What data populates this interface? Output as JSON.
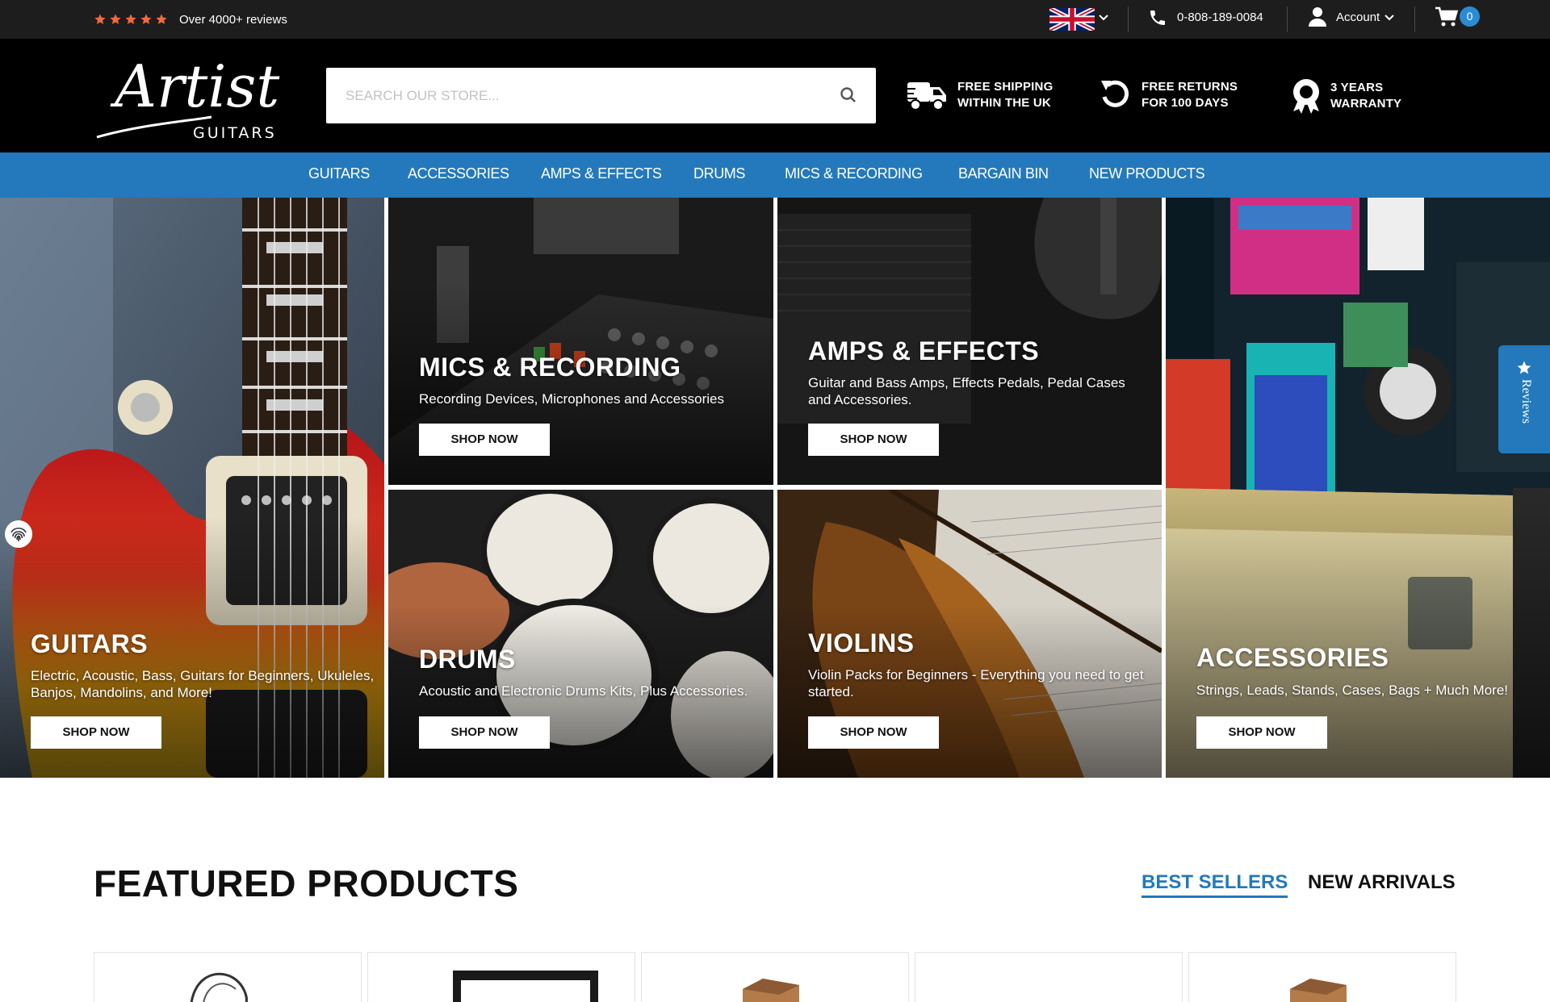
{
  "topbar": {
    "rating_stars": 5,
    "reviews_text": "Over 4000+ reviews",
    "phone": "0-808-189-0084",
    "account_label": "Account",
    "cart_count": "0"
  },
  "header": {
    "logo_script": "Artist",
    "logo_sub": "GUITARS",
    "search_placeholder": "SEARCH OUR STORE...",
    "perks": [
      {
        "line1": "FREE SHIPPING",
        "line2": "WITHIN THE UK",
        "icon": "truck-icon"
      },
      {
        "line1": "FREE RETURNS",
        "line2": "FOR 100 DAYS",
        "icon": "return-icon"
      },
      {
        "line1": "3 YEARS",
        "line2": "WARRANTY",
        "icon": "award-icon"
      }
    ]
  },
  "nav": {
    "items": [
      {
        "label": "GUITARS"
      },
      {
        "label": "ACCESSORIES"
      },
      {
        "label": "AMPS & EFFECTS"
      },
      {
        "label": "DRUMS"
      },
      {
        "label": "MICS & RECORDING"
      },
      {
        "label": "BARGAIN BIN"
      },
      {
        "label": "NEW PRODUCTS"
      }
    ]
  },
  "hero": {
    "shop_now": "SHOP NOW",
    "tiles": [
      {
        "title": "GUITARS",
        "subtitle": "Electric, Acoustic, Bass, Guitars for Beginners, Ukuleles, Banjos, Mandolins, and More!"
      },
      {
        "title": "MICS & RECORDING",
        "subtitle": "Recording Devices, Microphones and Accessories"
      },
      {
        "title": "AMPS & EFFECTS",
        "subtitle": "Guitar and Bass Amps, Effects Pedals, Pedal Cases and Accessories."
      },
      {
        "title": "DRUMS",
        "subtitle": "Acoustic and Electronic Drums Kits, Plus Accessories."
      },
      {
        "title": "VIOLINS",
        "subtitle": "Violin Packs for Beginners - Everything you need to get started."
      },
      {
        "title": "ACCESSORIES",
        "subtitle": "Strings, Leads, Stands, Cases, Bags + Much More!"
      }
    ]
  },
  "reviews_tab": {
    "label": "Reviews"
  },
  "featured": {
    "title": "FEATURED PRODUCTS",
    "tabs": [
      {
        "label": "BEST SELLERS",
        "active": true
      },
      {
        "label": "NEW ARRIVALS",
        "active": false
      }
    ]
  },
  "colors": {
    "nav_blue": "#2379bb",
    "topbar": "#1d1d1d",
    "header": "#000000",
    "star": "#f26b3a"
  }
}
